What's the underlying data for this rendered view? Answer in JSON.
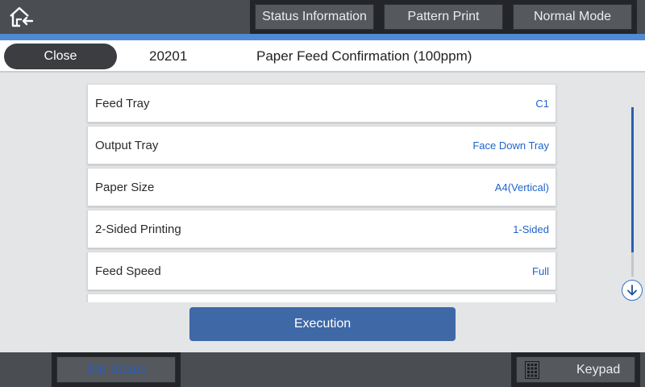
{
  "top": {
    "status_information": "Status Information",
    "pattern_print": "Pattern Print",
    "normal_mode": "Normal Mode"
  },
  "titlebar": {
    "close": "Close",
    "job_code": "20201",
    "title": "Paper Feed Confirmation (100ppm)"
  },
  "settings": [
    {
      "label": "Feed Tray",
      "value": "C1"
    },
    {
      "label": "Output Tray",
      "value": "Face Down Tray"
    },
    {
      "label": "Paper Size",
      "value": "A4(Vertical)"
    },
    {
      "label": "2-Sided Printing",
      "value": "1-Sided"
    },
    {
      "label": "Feed Speed",
      "value": "Full"
    }
  ],
  "execution": "Execution",
  "bottom": {
    "job_status": "Job Status",
    "keypad": "Keypad"
  },
  "colors": {
    "accent": "#4f8bd1",
    "value_text": "#1f63c8",
    "execution_button": "#3f68a6",
    "bar_background": "#4a4d52"
  },
  "icons": {
    "home": "home-icon",
    "scroll_down": "arrow-down-circle-icon",
    "keypad": "keypad-icon"
  }
}
